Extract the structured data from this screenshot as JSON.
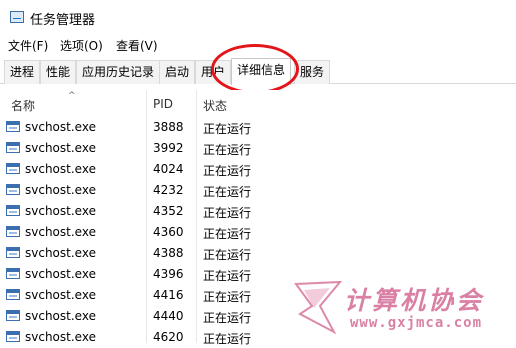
{
  "window": {
    "title": "任务管理器"
  },
  "menu": {
    "file": "文件(F)",
    "options": "选项(O)",
    "view": "查看(V)"
  },
  "tabs": [
    "进程",
    "性能",
    "应用历史记录",
    "启动",
    "用户",
    "详细信息",
    "服务"
  ],
  "active_tab": "详细信息",
  "columns": {
    "name": "名称",
    "pid": "PID",
    "status": "状态"
  },
  "rows": [
    {
      "name": "svchost.exe",
      "pid": "3888",
      "status": "正在运行"
    },
    {
      "name": "svchost.exe",
      "pid": "3992",
      "status": "正在运行"
    },
    {
      "name": "svchost.exe",
      "pid": "4024",
      "status": "正在运行"
    },
    {
      "name": "svchost.exe",
      "pid": "4232",
      "status": "正在运行"
    },
    {
      "name": "svchost.exe",
      "pid": "4352",
      "status": "正在运行"
    },
    {
      "name": "svchost.exe",
      "pid": "4360",
      "status": "正在运行"
    },
    {
      "name": "svchost.exe",
      "pid": "4388",
      "status": "正在运行"
    },
    {
      "name": "svchost.exe",
      "pid": "4396",
      "status": "正在运行"
    },
    {
      "name": "svchost.exe",
      "pid": "4416",
      "status": "正在运行"
    },
    {
      "name": "svchost.exe",
      "pid": "4440",
      "status": "正在运行"
    },
    {
      "name": "svchost.exe",
      "pid": "4620",
      "status": "正在运行"
    }
  ],
  "watermark": {
    "name": "计算机协会",
    "url": "www.gxjmca.com"
  },
  "colors": {
    "annotation": "#e3151a",
    "watermark": "#d36b95",
    "icon": "#3b6fb0"
  }
}
